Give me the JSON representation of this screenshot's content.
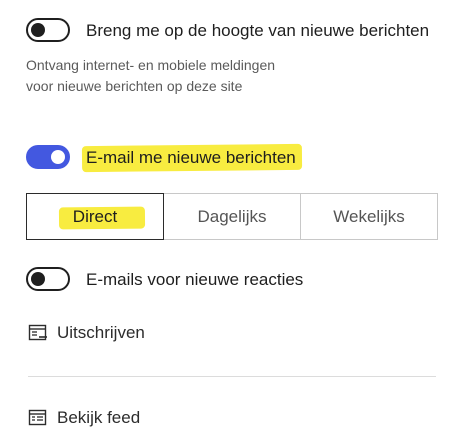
{
  "notify_toggle": {
    "label": "Breng me op de hoogte van nieuwe berichten",
    "state": "off",
    "description": "Ontvang internet- en mobiele meldingen voor nieuwe berichten op deze site"
  },
  "email_toggle": {
    "label": "E-mail me nieuwe berichten",
    "state": "on",
    "accent_color": "#4358e0"
  },
  "frequency": {
    "options": [
      "Direct",
      "Dagelijks",
      "Wekelijks"
    ],
    "selected": "Direct"
  },
  "comments_toggle": {
    "label": "E-mails voor nieuwe reacties",
    "state": "off"
  },
  "unsubscribe": {
    "label": "Uitschrijven",
    "icon": "unsubscribe-icon"
  },
  "feed": {
    "label": "Bekijk feed",
    "icon": "feed-icon"
  },
  "highlight_color": "#f8ec40"
}
